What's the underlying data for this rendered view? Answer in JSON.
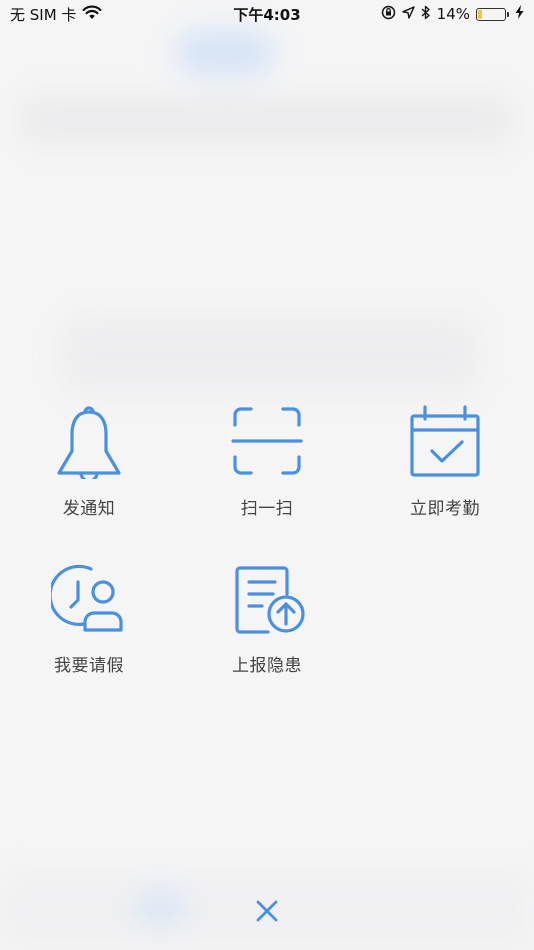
{
  "status_bar": {
    "carrier": "无 SIM 卡",
    "time": "下午4:03",
    "battery_percent": "14%",
    "battery_level": 0.14,
    "icons": [
      "wifi-icon",
      "orientation-lock-icon",
      "location-icon",
      "bluetooth-icon",
      "battery-icon",
      "charging-icon"
    ]
  },
  "actions": [
    {
      "label": "发通知",
      "icon": "bell-icon"
    },
    {
      "label": "扫一扫",
      "icon": "scan-icon"
    },
    {
      "label": "立即考勤",
      "icon": "calendar-check-icon"
    },
    {
      "label": "我要请假",
      "icon": "clock-person-icon"
    },
    {
      "label": "上报隐患",
      "icon": "document-upload-icon"
    }
  ],
  "close": {
    "icon": "close-icon"
  },
  "colors": {
    "accent": "#4a90e2",
    "background": "#f5f5f6",
    "label": "#444444",
    "battery_low": "#f6c445"
  }
}
